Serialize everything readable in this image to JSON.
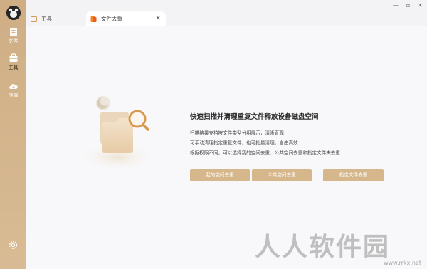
{
  "sidebar": {
    "items": [
      {
        "label": "文件",
        "icon": "file-icon"
      },
      {
        "label": "工具",
        "icon": "toolbox-icon"
      },
      {
        "label": "传输",
        "icon": "cloud-transfer-icon"
      }
    ],
    "active_index": 1,
    "settings_icon": "gear-icon"
  },
  "tabs": [
    {
      "label": "工具",
      "icon": "tools-tab-icon"
    },
    {
      "label": "文件去重",
      "icon": "dedupe-tab-icon",
      "active": true
    }
  ],
  "window_controls": {
    "minimize": "—",
    "maximize": "▫",
    "close": "✕"
  },
  "main": {
    "headline": "快速扫描并清理重复文件释放设备磁盘空间",
    "descriptions": [
      "扫描结果支持按文件类型分组展示，清晰直观",
      "可手动清理指定重复文件，也可批量清理，自由高效",
      "根据权限不同，可以选择我的空间去重、公共空间去重和指定文件夹去重"
    ],
    "buttons": [
      "我的空间去重",
      "公共空间去重",
      "指定文件去重"
    ]
  },
  "watermark": {
    "text": "人人软件园",
    "url": "www.rrkx.net"
  },
  "colors": {
    "accent": "#d6b78c",
    "sidebar": "#cfae84"
  }
}
